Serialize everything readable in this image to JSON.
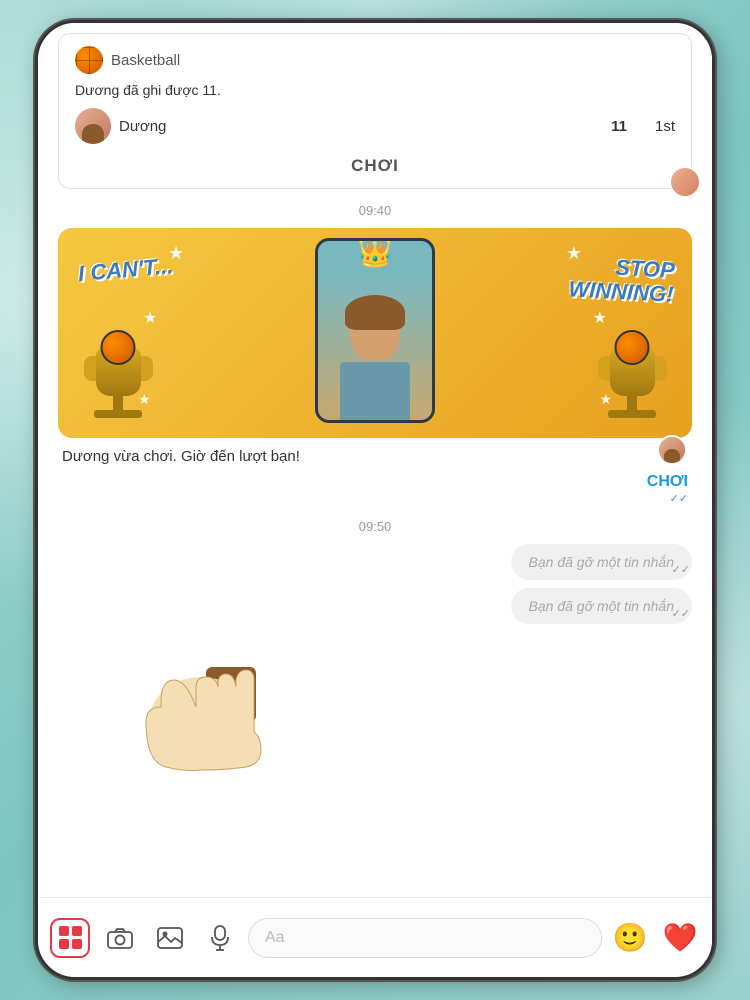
{
  "background": {
    "color": "#a8dcd9"
  },
  "chat": {
    "game_card": {
      "label": "Basketball",
      "score_text": "Dương đã ghi được 11.",
      "player_name": "Dương",
      "score": "11",
      "rank": "1st",
      "play_button": "CHƠI"
    },
    "timestamp1": "09:40",
    "win_banner": {
      "left_text_line1": "I CAN'T...",
      "right_text_line1": "STOP",
      "right_text_line2": "WINNING!",
      "message": "Dương vừa chơi. Giờ đến lượt bạn!",
      "play_link": "CHƠI"
    },
    "timestamp2": "09:50",
    "deleted_messages": [
      "Bạn đã gỡ một tin nhắn",
      "Bạn đã gỡ một tin nhắn"
    ]
  },
  "toolbar": {
    "input_placeholder": "Aa"
  }
}
